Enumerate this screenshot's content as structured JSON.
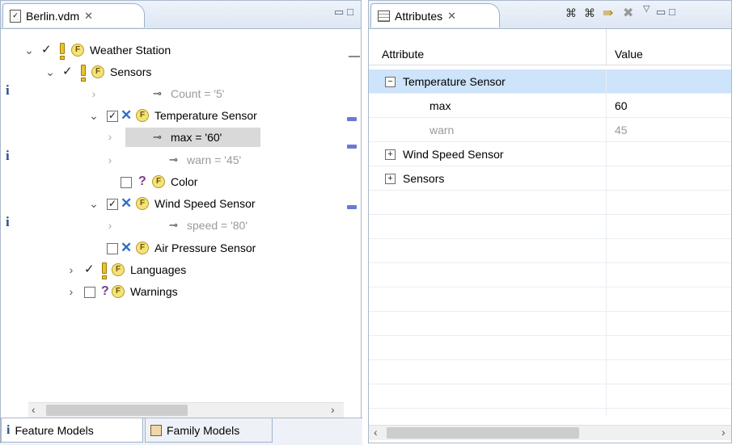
{
  "left_view": {
    "tab_title": "Berlin.vdm",
    "tree": [
      {
        "label": "Weather Station"
      },
      {
        "label": "Sensors"
      },
      {
        "label": "Count = '5'"
      },
      {
        "label": "Temperature Sensor"
      },
      {
        "label": "max = '60'"
      },
      {
        "label": "warn = '45'"
      },
      {
        "label": "Color"
      },
      {
        "label": "Wind Speed Sensor"
      },
      {
        "label": "speed = '80'"
      },
      {
        "label": "Air Pressure Sensor"
      },
      {
        "label": "Languages"
      },
      {
        "label": "Warnings"
      }
    ],
    "bottom_tabs": [
      "Feature Models",
      "Family Models"
    ]
  },
  "right_view": {
    "tab_title": "Attributes",
    "columns": [
      "Attribute",
      "Value"
    ],
    "rows": [
      {
        "attribute": "Temperature Sensor",
        "value": ""
      },
      {
        "attribute": "max",
        "value": "60"
      },
      {
        "attribute": "warn",
        "value": "45"
      },
      {
        "attribute": "Wind Speed Sensor",
        "value": ""
      },
      {
        "attribute": "Sensors",
        "value": ""
      }
    ]
  },
  "colors": {
    "selection": "#cde4fb",
    "tree_selection": "#d9d9d9",
    "marker": "#6b78d6"
  }
}
